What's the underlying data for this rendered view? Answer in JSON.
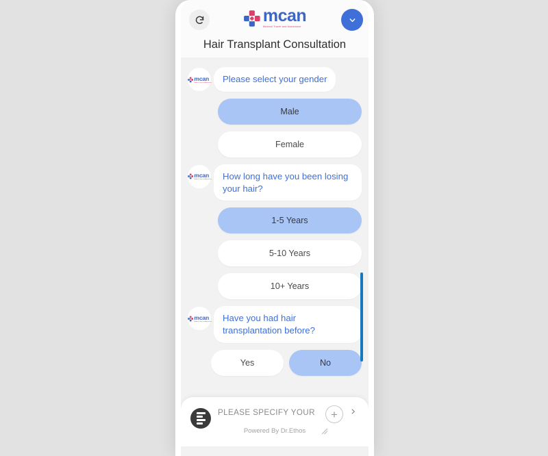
{
  "page": {
    "background_color": "#e2e2e2"
  },
  "widget": {
    "header": {
      "refresh_icon": "refresh-icon",
      "collapse_icon": "chevron-down-icon",
      "brand": {
        "icon": "medical-cross-icon",
        "name": "mcan",
        "tagline": "Medical Travel and Assistance",
        "name_color": "#3d66c4",
        "tagline_color": "#d9406a"
      },
      "title": "Hair Transplant Consultation"
    },
    "accent_color": "#3f6fd8",
    "selected_option_color": "#a8c5f6",
    "scrollbar_color": "#1479bd",
    "conversation": [
      {
        "id": "gender",
        "avatar_icon": "mcan-avatar-icon",
        "message": "Please select your gender",
        "layout": "stacked",
        "options": [
          {
            "label": "Male",
            "selected": true
          },
          {
            "label": "Female",
            "selected": false
          }
        ]
      },
      {
        "id": "duration",
        "avatar_icon": "mcan-avatar-icon",
        "message": "How long have you been losing your hair?",
        "layout": "stacked",
        "options": [
          {
            "label": "1-5 Years",
            "selected": true
          },
          {
            "label": "5-10 Years",
            "selected": false
          },
          {
            "label": "10+ Years",
            "selected": false
          }
        ]
      },
      {
        "id": "previous-transplant",
        "avatar_icon": "mcan-avatar-icon",
        "message": "Have you had hair transplantation before?",
        "layout": "inline",
        "options": [
          {
            "label": "Yes",
            "selected": false
          },
          {
            "label": "No",
            "selected": true
          }
        ]
      }
    ],
    "composer": {
      "menu_icon": "list-menu-icon",
      "input_value": "",
      "input_placeholder": "PLEASE SPECIFY YOUR NEED",
      "attach_icon": "plus-circle-icon",
      "send_icon": "chevron-right-icon",
      "powered_by": "Powered By Dr.Ethos",
      "resize_icon": "resize-handle-icon"
    }
  }
}
